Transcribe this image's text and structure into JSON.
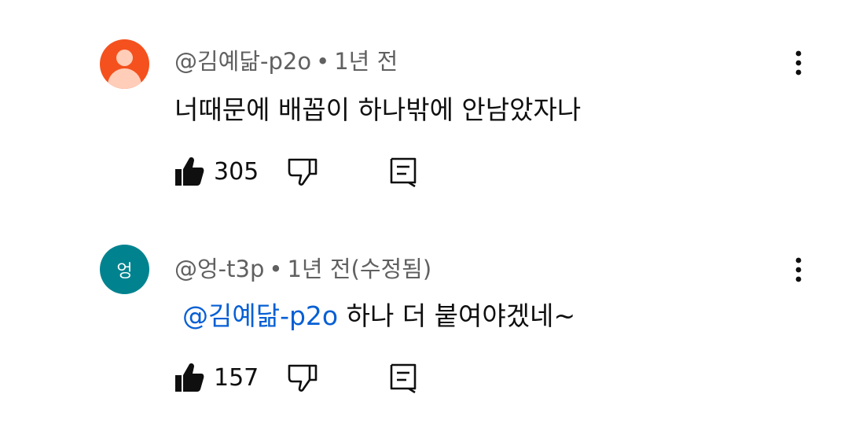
{
  "comments": [
    {
      "author": "@김예닮-p2o",
      "separator": "•",
      "time": "1년 전",
      "avatar_type": "default-person-icon",
      "avatar_color": "#f4511e",
      "text": "너때문에 배꼽이 하나밖에 안남았자나",
      "mention": "",
      "likes": "305"
    },
    {
      "author": "@엉-t3p",
      "separator": "•",
      "time": "1년 전(수정됨)",
      "avatar_type": "letter",
      "avatar_letter": "엉",
      "avatar_color": "#00838f",
      "text": "하나 더 붙여야겠네~",
      "mention": "@김예닮-p2o",
      "likes": "157"
    }
  ],
  "icons": {
    "like": "thumbs-up-icon",
    "dislike": "thumbs-down-icon",
    "reply": "comment-reply-icon",
    "more": "more-vertical-icon"
  },
  "colors": {
    "mention": "#065fd4",
    "meta": "#606060",
    "text": "#0f0f0f"
  }
}
